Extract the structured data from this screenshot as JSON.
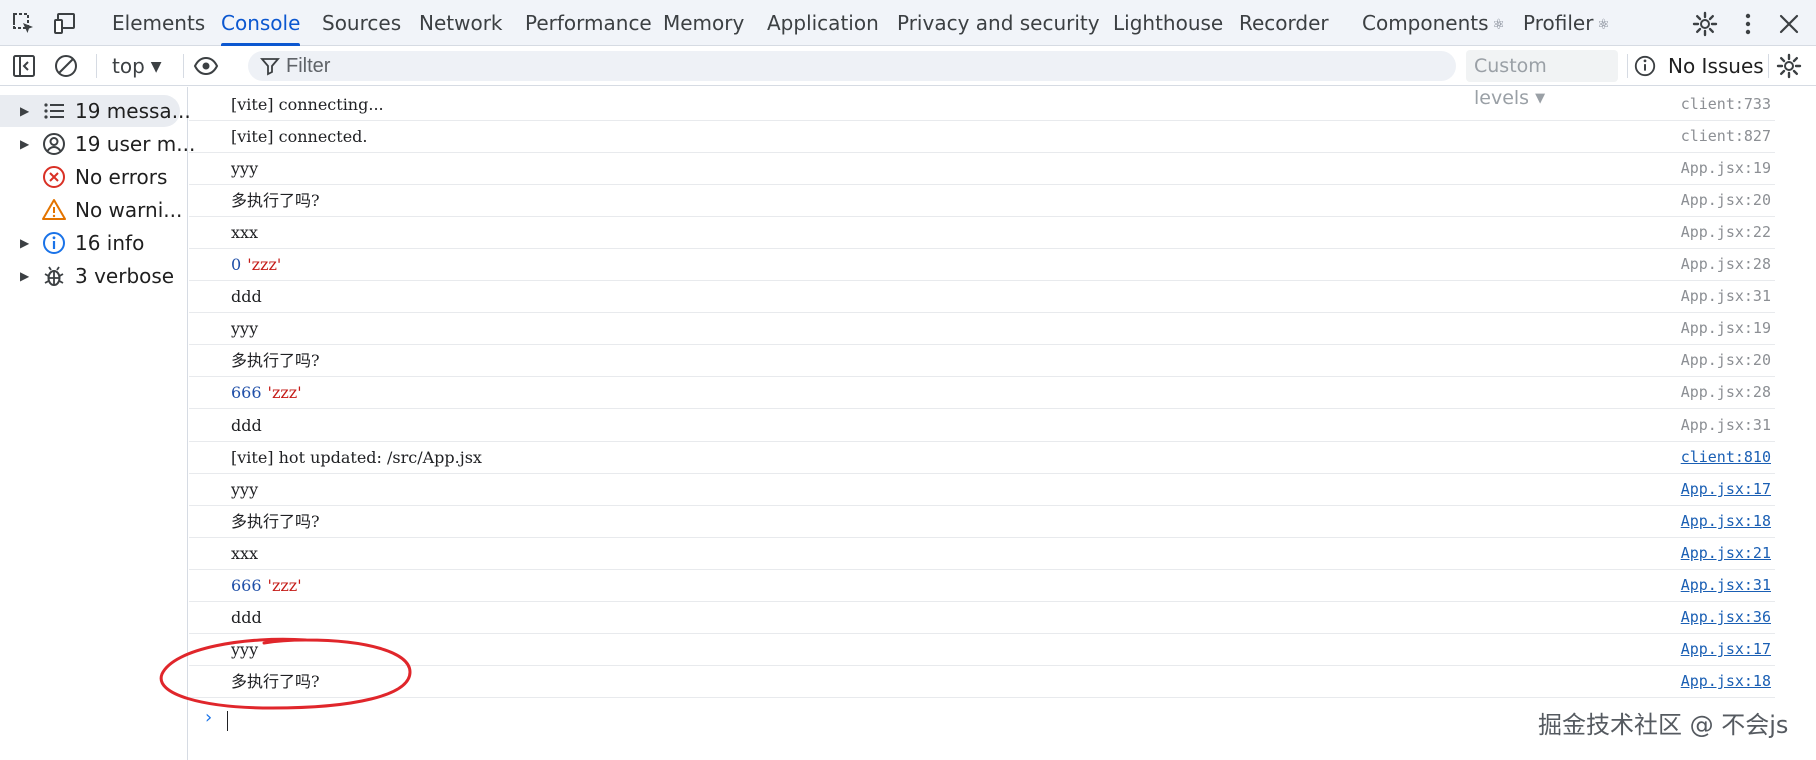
{
  "tabbar": {
    "tabs": [
      {
        "label": "Elements",
        "react": false
      },
      {
        "label": "Console",
        "react": false,
        "active": true
      },
      {
        "label": "Sources",
        "react": false
      },
      {
        "label": "Network",
        "react": false
      },
      {
        "label": "Performance",
        "react": false
      },
      {
        "label": "Memory",
        "react": false
      },
      {
        "label": "Application",
        "react": false
      },
      {
        "label": "Privacy and security",
        "react": false
      },
      {
        "label": "Lighthouse",
        "react": false
      },
      {
        "label": "Recorder",
        "react": false
      },
      {
        "label": "Components",
        "react": true
      },
      {
        "label": "Profiler",
        "react": true
      }
    ],
    "react_glyph": "⚛"
  },
  "toolbar": {
    "context": "top",
    "caret": "▼",
    "filter_placeholder": "Filter",
    "levels_label": "Custom levels",
    "issues_label": "No Issues"
  },
  "sidebar": {
    "items": [
      {
        "label": "19 messa...",
        "icon": "list-icon",
        "expandable": true,
        "selected": true
      },
      {
        "label": "19 user m...",
        "icon": "user-circle-icon",
        "expandable": true
      },
      {
        "label": "No errors",
        "icon": "error-icon",
        "expandable": false
      },
      {
        "label": "No warni...",
        "icon": "warning-icon",
        "expandable": false
      },
      {
        "label": "16 info",
        "icon": "info-icon",
        "expandable": true
      },
      {
        "label": "3 verbose",
        "icon": "bug-icon",
        "expandable": true
      }
    ],
    "triangle": "▶"
  },
  "log": [
    {
      "text": "[vite] connecting...",
      "source": "client:733",
      "link": false
    },
    {
      "text": "[vite] connected.",
      "source": "client:827",
      "link": false
    },
    {
      "text": "yyy",
      "source": "App.jsx:19",
      "link": false
    },
    {
      "text": "多执行了吗?",
      "source": "App.jsx:20",
      "link": false
    },
    {
      "text": "xxx",
      "source": "App.jsx:22",
      "link": false
    },
    {
      "num": "0",
      "str": "'zzz'",
      "source": "App.jsx:28",
      "link": false
    },
    {
      "text": "ddd",
      "source": "App.jsx:31",
      "link": false
    },
    {
      "text": "yyy",
      "source": "App.jsx:19",
      "link": false
    },
    {
      "text": "多执行了吗?",
      "source": "App.jsx:20",
      "link": false
    },
    {
      "num": "666",
      "str": "'zzz'",
      "source": "App.jsx:28",
      "link": false
    },
    {
      "text": "ddd",
      "source": "App.jsx:31",
      "link": false
    },
    {
      "text": "[vite] hot updated: /src/App.jsx",
      "source": "client:810",
      "link": true
    },
    {
      "text": "yyy",
      "source": "App.jsx:17",
      "link": true
    },
    {
      "text": "多执行了吗?",
      "source": "App.jsx:18",
      "link": true
    },
    {
      "text": "xxx",
      "source": "App.jsx:21",
      "link": true
    },
    {
      "num": "666",
      "str": "'zzz'",
      "source": "App.jsx:31",
      "link": true
    },
    {
      "text": "ddd",
      "source": "App.jsx:36",
      "link": true
    },
    {
      "text": "yyy",
      "source": "App.jsx:17",
      "link": true
    },
    {
      "text": "多执行了吗?",
      "source": "App.jsx:18",
      "link": true
    }
  ],
  "prompt": {
    "chevron": "›"
  },
  "watermark": "掘金技术社区 @ 不会js",
  "colors": {
    "accent": "#0b57d0",
    "error": "#d93025",
    "warning": "#e37400",
    "info": "#1a73e8",
    "annotation": "#e0262b"
  }
}
